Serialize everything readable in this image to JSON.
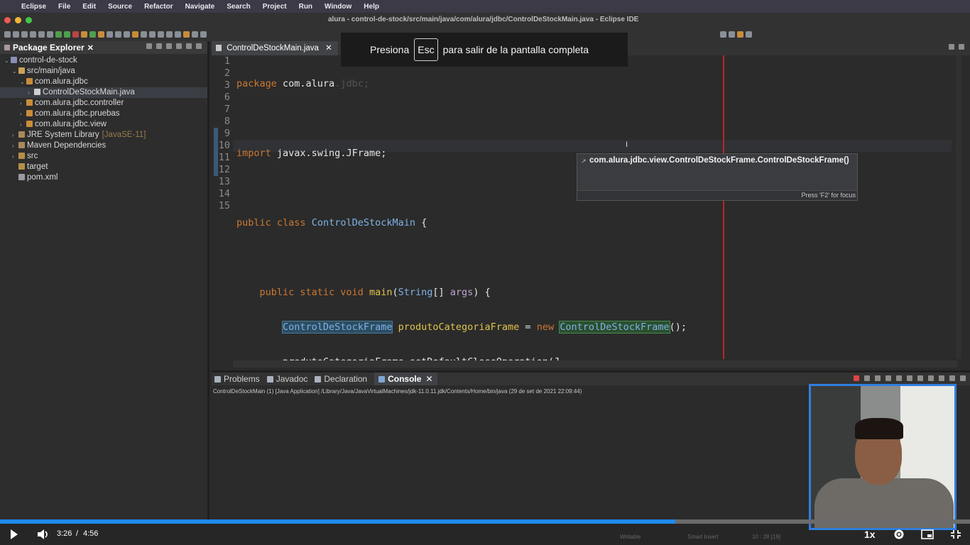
{
  "menubar": {
    "items": [
      "Eclipse",
      "File",
      "Edit",
      "Source",
      "Refactor",
      "Navigate",
      "Search",
      "Project",
      "Run",
      "Window",
      "Help"
    ]
  },
  "window": {
    "title": "alura - control-de-stock/src/main/java/com/alura/jdbc/ControlDeStockMain.java - Eclipse IDE"
  },
  "fullscreen_notice": {
    "before": "Presiona",
    "key": "Esc",
    "after": "para salir de la pantalla completa"
  },
  "package_explorer": {
    "title": "Package Explorer",
    "close": "✕",
    "tree": [
      {
        "label": "control-de-stock",
        "depth": 0,
        "arrow": "⌄",
        "icon": "project-icon"
      },
      {
        "label": "src/main/java",
        "depth": 1,
        "arrow": "⌄",
        "icon": "source-folder-icon"
      },
      {
        "label": "com.alura.jdbc",
        "depth": 2,
        "arrow": "⌄",
        "icon": "package-icon"
      },
      {
        "label": "ControlDeStockMain.java",
        "depth": 3,
        "arrow": "›",
        "icon": "java-file-icon",
        "selected": true
      },
      {
        "label": "com.alura.jdbc.controller",
        "depth": 2,
        "arrow": "›",
        "icon": "package-icon"
      },
      {
        "label": "com.alura.jdbc.pruebas",
        "depth": 2,
        "arrow": "›",
        "icon": "package-icon"
      },
      {
        "label": "com.alura.jdbc.view",
        "depth": 2,
        "arrow": "›",
        "icon": "package-icon"
      },
      {
        "label": "JRE System Library",
        "suffix": "[JavaSE-11]",
        "depth": 1,
        "arrow": "›",
        "icon": "library-icon"
      },
      {
        "label": "Maven Dependencies",
        "depth": 1,
        "arrow": "›",
        "icon": "library-icon"
      },
      {
        "label": "src",
        "depth": 1,
        "arrow": "›",
        "icon": "folder-icon"
      },
      {
        "label": "target",
        "depth": 1,
        "arrow": "",
        "icon": "folder-icon"
      },
      {
        "label": "pom.xml",
        "depth": 1,
        "arrow": "",
        "icon": "xml-file-icon"
      }
    ]
  },
  "editor": {
    "tab_label": "ControlDeStockMain.java",
    "tab_close": "✕",
    "line_numbers": [
      "1",
      "2",
      "3",
      "6",
      "7",
      "8",
      "9",
      "10",
      "11",
      "12",
      "13",
      "14",
      "15"
    ],
    "tooltip": {
      "signature": "com.alura.jdbc.view.ControlDeStockFrame.ControlDeStockFrame()",
      "footer": "Press 'F2' for focus"
    }
  },
  "console": {
    "tabs": [
      {
        "label": "Problems",
        "icon": "problems-icon"
      },
      {
        "label": "Javadoc",
        "icon": "javadoc-icon"
      },
      {
        "label": "Declaration",
        "icon": "declaration-icon"
      },
      {
        "label": "Console",
        "icon": "console-icon",
        "active": true
      }
    ],
    "close": "✕",
    "info": "ControlDeStockMain (1) [Java Application] /Library/Java/JavaVirtualMachines/jdk-11.0.11.jdk/Contents/Home/bin/java  (29 de set de 2021 22:09:44)"
  },
  "status": {
    "writable": "Writable",
    "insert_mode": "Smart Insert",
    "position": "10 : 28 [19]"
  },
  "player": {
    "current_time": "3:26",
    "separator": "/",
    "duration": "4:56",
    "progress_fraction": 0.696,
    "speed": "1x"
  },
  "colors": {
    "accent": "#1f8af0",
    "ruler": "#b8272b"
  }
}
